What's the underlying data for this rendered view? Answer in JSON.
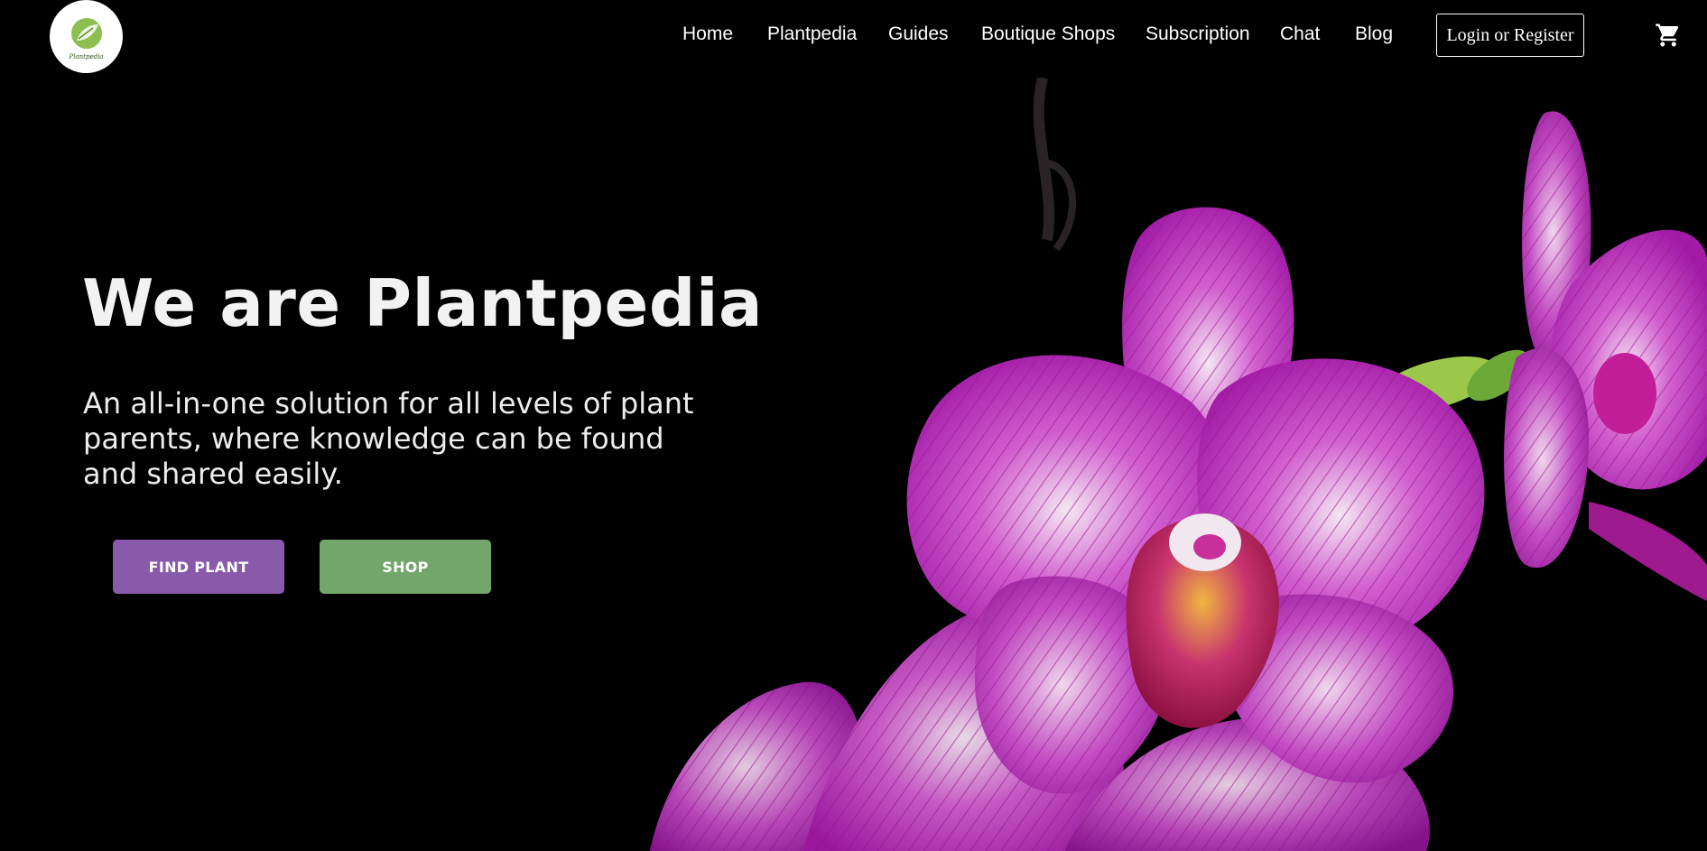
{
  "header": {
    "logo_text": "Plantpedia",
    "nav": [
      {
        "label": "Home"
      },
      {
        "label": "Plantpedia"
      },
      {
        "label": "Guides"
      },
      {
        "label": "Boutique Shops"
      },
      {
        "label": "Subscription"
      },
      {
        "label": "Chat"
      },
      {
        "label": "Blog"
      }
    ],
    "login_label": "Login or Register",
    "cart_icon": "shopping-cart-icon"
  },
  "hero": {
    "title": "We are Plantpedia",
    "subtitle": "An all-in-one solution for all levels of plant parents, where knowledge can be found and shared easily.",
    "find_plant_label": "FIND PLANT",
    "shop_label": "SHOP",
    "image": "orchid-photo"
  },
  "colors": {
    "background": "#000000",
    "find_plant_button": "#8a5aaa",
    "shop_button": "#72a66a",
    "text": "#ffffff"
  }
}
